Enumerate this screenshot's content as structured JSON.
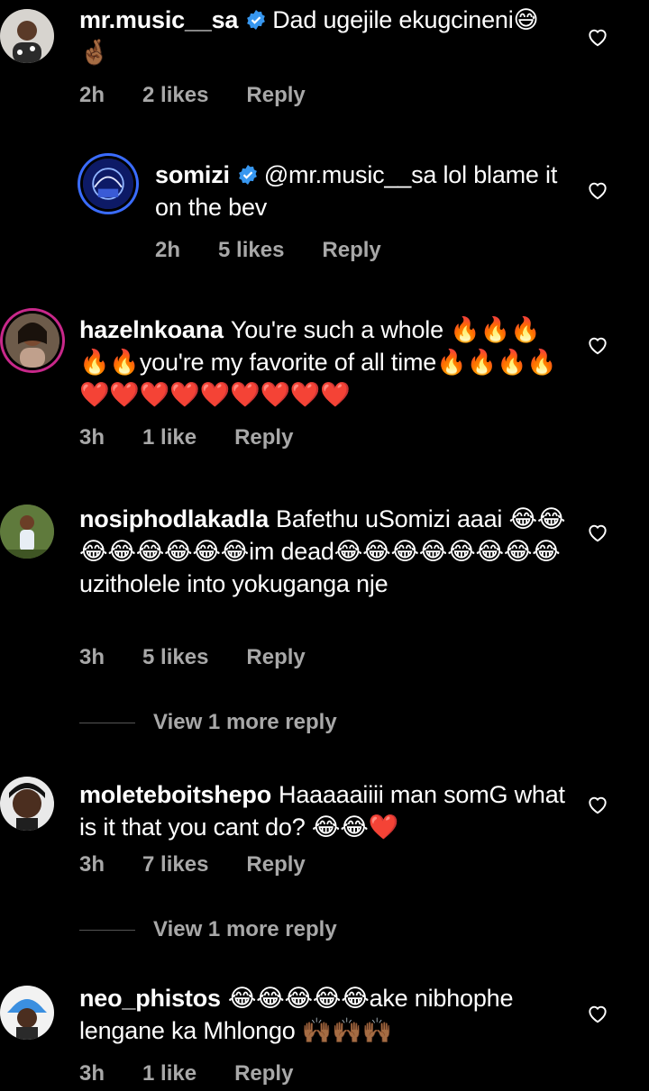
{
  "icons": {
    "like": "heart-outline-icon",
    "verified": "verified-badge-icon"
  },
  "colors": {
    "background": "#000000",
    "muted": "#a8a8a8",
    "verified": "#3797f0"
  },
  "comments": [
    {
      "username": "mr.music__sa",
      "verified": true,
      "text": "Dad ugejile ekugcineni😅🤞🏾",
      "time": "2h",
      "likes": "2 likes",
      "reply": "Reply"
    },
    {
      "username": "somizi",
      "verified": true,
      "text": "@mr.music__sa lol blame it on the bev",
      "time": "2h",
      "likes": "5 likes",
      "reply": "Reply"
    },
    {
      "username": "hazelnkoana",
      "verified": false,
      "text": "You're such a whole 🔥🔥🔥🔥🔥you're my favorite of all time🔥🔥🔥🔥❤️❤️❤️❤️❤️❤️❤️❤️❤️",
      "time": "3h",
      "likes": "1 like",
      "reply": "Reply"
    },
    {
      "username": "nosiphodlakadla",
      "verified": false,
      "text": "Bafethu uSomizi aaai 😂😂😂😂😂😂😂😂im dead😂😂😂😂😂😂😂😂uzitholele into yokuganga nje",
      "time": "3h",
      "likes": "5 likes",
      "reply": "Reply",
      "more": "View 1 more reply"
    },
    {
      "username": "moleteboitshepo",
      "verified": false,
      "text": "Haaaaaiiii man somG what is it that you cant do? 😂😂❤️",
      "time": "3h",
      "likes": "7 likes",
      "reply": "Reply",
      "more": "View 1 more reply"
    },
    {
      "username": "neo_phistos",
      "verified": false,
      "text": "😂😂😂😂😂ake nibhophe lengane ka Mhlongo 🙌🏾🙌🏾🙌🏾",
      "time": "3h",
      "likes": "1 like",
      "reply": "Reply"
    }
  ]
}
